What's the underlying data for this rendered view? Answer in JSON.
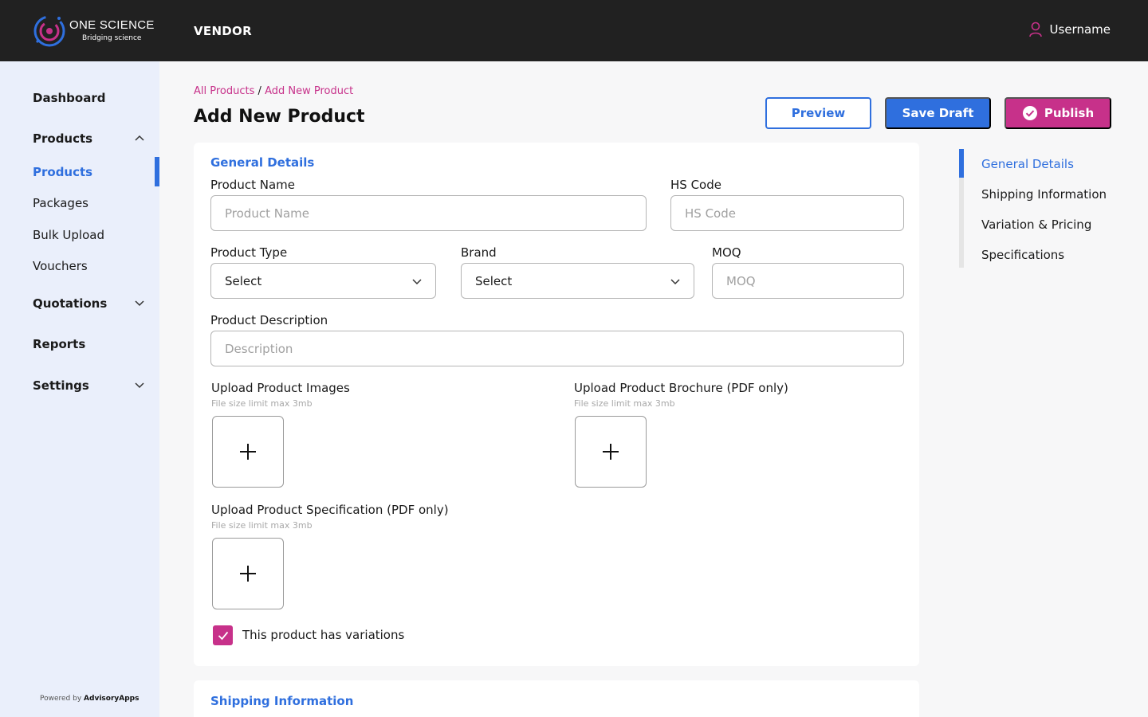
{
  "header": {
    "logo_title": "ONE SCIENCE",
    "logo_subtitle": "Bridging science",
    "section": "VENDOR",
    "username": "Username"
  },
  "sidebar": {
    "items": [
      {
        "label": "Dashboard"
      },
      {
        "label": "Products"
      },
      {
        "label": "Products"
      },
      {
        "label": "Packages"
      },
      {
        "label": "Bulk Upload"
      },
      {
        "label": "Vouchers"
      },
      {
        "label": "Quotations"
      },
      {
        "label": "Reports"
      },
      {
        "label": "Settings"
      }
    ],
    "powered_prefix": "Powered by",
    "powered_brand": "AdvisoryApps"
  },
  "breadcrumb": {
    "root": "All Products",
    "separator": "/",
    "current": "Add New Product"
  },
  "page": {
    "title": "Add New Product"
  },
  "actions": {
    "preview": "Preview",
    "save_draft": "Save Draft",
    "publish": "Publish"
  },
  "general": {
    "section_title": "General Details",
    "product_name": {
      "label": "Product Name",
      "placeholder": "Product Name"
    },
    "hs_code": {
      "label": "HS Code",
      "placeholder": "HS Code"
    },
    "product_type": {
      "label": "Product Type",
      "value": "Select"
    },
    "brand": {
      "label": "Brand",
      "value": "Select"
    },
    "moq": {
      "label": "MOQ",
      "placeholder": "MOQ"
    },
    "description": {
      "label": "Product Description",
      "placeholder": "Description"
    },
    "upload_images": {
      "label": "Upload Product Images",
      "hint": "File size limit max 3mb"
    },
    "upload_brochure": {
      "label": "Upload Product Brochure (PDF only)",
      "hint": "File size limit max 3mb"
    },
    "upload_spec": {
      "label": "Upload Product Specification (PDF only)",
      "hint": "File size limit max 3mb"
    },
    "variations": {
      "label": "This product has variations",
      "checked": true
    }
  },
  "shipping": {
    "section_title": "Shipping Information"
  },
  "toc": {
    "items": [
      {
        "label": "General Details"
      },
      {
        "label": "Shipping Information"
      },
      {
        "label": "Variation & Pricing"
      },
      {
        "label": "Specifications"
      }
    ]
  },
  "colors": {
    "accent_blue": "#2f6fde",
    "accent_magenta": "#c7318a",
    "topbar": "#212121",
    "sidebar_bg": "#eaeffb"
  }
}
